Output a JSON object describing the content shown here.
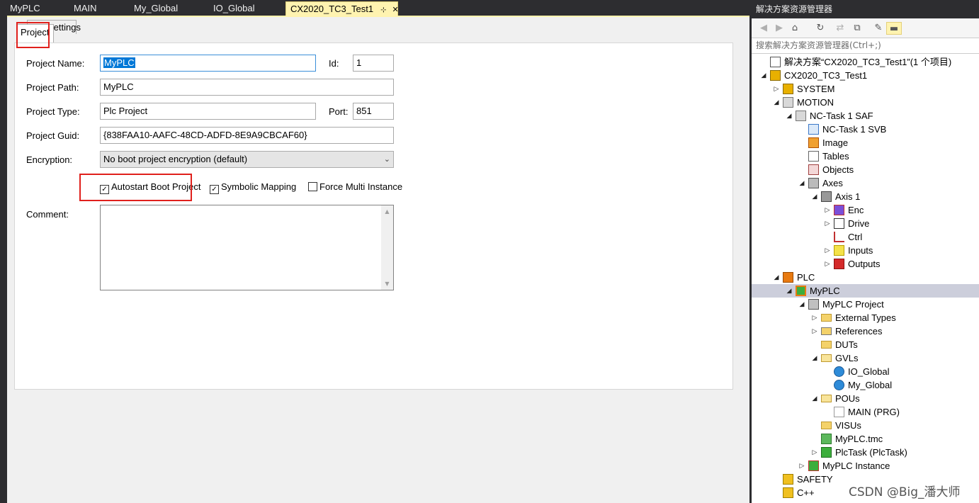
{
  "doc_tabs": {
    "tabs": [
      "MyPLC",
      "MAIN",
      "My_Global",
      "IO_Global",
      "CX2020_TC3_Test1"
    ],
    "active_tab": "CX2020_TC3_Test1",
    "pin_glyph": "⊹",
    "close_glyph": "✕"
  },
  "editor": {
    "tabs": [
      "Project",
      "Settings"
    ],
    "active_tab": "Project",
    "fields": {
      "project_name_label": "Project Name:",
      "project_name_value": "MyPLC",
      "id_label": "Id:",
      "id_value": "1",
      "project_path_label": "Project Path:",
      "project_path_value": "MyPLC",
      "project_type_label": "Project Type:",
      "project_type_value": "Plc Project",
      "port_label": "Port:",
      "port_value": "851",
      "project_guid_label": "Project Guid:",
      "project_guid_value": "{838FAA10-AAFC-48CD-ADFD-8E9A9CBCAF60}",
      "encryption_label": "Encryption:",
      "encryption_value": "No boot project encryption (default)",
      "comment_label": "Comment:"
    },
    "checkboxes": {
      "autostart_label": "Autostart Boot Project",
      "autostart_checked": true,
      "symbolic_label": "Symbolic Mapping",
      "symbolic_checked": true,
      "force_multi_label": "Force Multi Instance",
      "force_multi_checked": false
    },
    "highlight_color": "#e0201c"
  },
  "solution_explorer": {
    "title": "解决方案资源管理器",
    "search_placeholder": "搜索解决方案资源管理器(Ctrl+;)",
    "toolbar_icons": [
      "back-icon",
      "forward-icon",
      "home-icon",
      "sync-icon",
      "refresh-icon",
      "collapse-all-icon",
      "properties-icon",
      "pin-icon"
    ],
    "tree": [
      {
        "label": "解决方案“CX2020_TC3_Test1”(1 个项目)",
        "level": 0,
        "expander": "",
        "icon": "solution-icon"
      },
      {
        "label": "CX2020_TC3_Test1",
        "level": 0,
        "expander": "expanded",
        "icon": "project-icon"
      },
      {
        "label": "SYSTEM",
        "level": 1,
        "expander": "collapsed",
        "icon": "system-icon"
      },
      {
        "label": "MOTION",
        "level": 1,
        "expander": "expanded",
        "icon": "motion-icon"
      },
      {
        "label": "NC-Task 1 SAF",
        "level": 2,
        "expander": "expanded",
        "icon": "nc-task-icon"
      },
      {
        "label": "NC-Task 1 SVB",
        "level": 3,
        "expander": "",
        "icon": "document-icon"
      },
      {
        "label": "Image",
        "level": 3,
        "expander": "",
        "icon": "image-icon"
      },
      {
        "label": "Tables",
        "level": 3,
        "expander": "",
        "icon": "table-icon"
      },
      {
        "label": "Objects",
        "level": 3,
        "expander": "",
        "icon": "objects-icon"
      },
      {
        "label": "Axes",
        "level": 3,
        "expander": "expanded",
        "icon": "axes-icon"
      },
      {
        "label": "Axis 1",
        "level": 4,
        "expander": "expanded",
        "icon": "axis-icon"
      },
      {
        "label": "Enc",
        "level": 5,
        "expander": "collapsed",
        "icon": "encoder-icon"
      },
      {
        "label": "Drive",
        "level": 5,
        "expander": "collapsed",
        "icon": "drive-icon"
      },
      {
        "label": "Ctrl",
        "level": 5,
        "expander": "",
        "icon": "controller-icon"
      },
      {
        "label": "Inputs",
        "level": 5,
        "expander": "collapsed",
        "icon": "inputs-icon"
      },
      {
        "label": "Outputs",
        "level": 5,
        "expander": "collapsed",
        "icon": "outputs-icon"
      },
      {
        "label": "PLC",
        "level": 1,
        "expander": "expanded",
        "icon": "plc-icon"
      },
      {
        "label": "MyPLC",
        "level": 2,
        "expander": "expanded",
        "icon": "plc-project-icon",
        "selected": true
      },
      {
        "label": "MyPLC Project",
        "level": 3,
        "expander": "expanded",
        "icon": "plc-subproject-icon"
      },
      {
        "label": "External Types",
        "level": 4,
        "expander": "collapsed",
        "icon": "folder-icon"
      },
      {
        "label": "References",
        "level": 4,
        "expander": "collapsed",
        "icon": "references-icon"
      },
      {
        "label": "DUTs",
        "level": 4,
        "expander": "",
        "icon": "folder-icon"
      },
      {
        "label": "GVLs",
        "level": 4,
        "expander": "expanded",
        "icon": "folder-open-icon"
      },
      {
        "label": "IO_Global",
        "level": 5,
        "expander": "",
        "icon": "gvl-icon"
      },
      {
        "label": "My_Global",
        "level": 5,
        "expander": "",
        "icon": "gvl-icon"
      },
      {
        "label": "POUs",
        "level": 4,
        "expander": "expanded",
        "icon": "folder-open-icon"
      },
      {
        "label": "MAIN (PRG)",
        "level": 5,
        "expander": "",
        "icon": "pou-icon"
      },
      {
        "label": "VISUs",
        "level": 4,
        "expander": "",
        "icon": "folder-icon"
      },
      {
        "label": "MyPLC.tmc",
        "level": 4,
        "expander": "",
        "icon": "tmc-icon"
      },
      {
        "label": "PlcTask (PlcTask)",
        "level": 4,
        "expander": "collapsed",
        "icon": "task-icon"
      },
      {
        "label": "MyPLC Instance",
        "level": 3,
        "expander": "collapsed",
        "icon": "instance-icon"
      },
      {
        "label": "SAFETY",
        "level": 1,
        "expander": "",
        "icon": "safety-icon"
      },
      {
        "label": "C++",
        "level": 1,
        "expander": "",
        "icon": "cpp-icon"
      }
    ]
  },
  "watermark": "CSDN @Big_潘大师"
}
